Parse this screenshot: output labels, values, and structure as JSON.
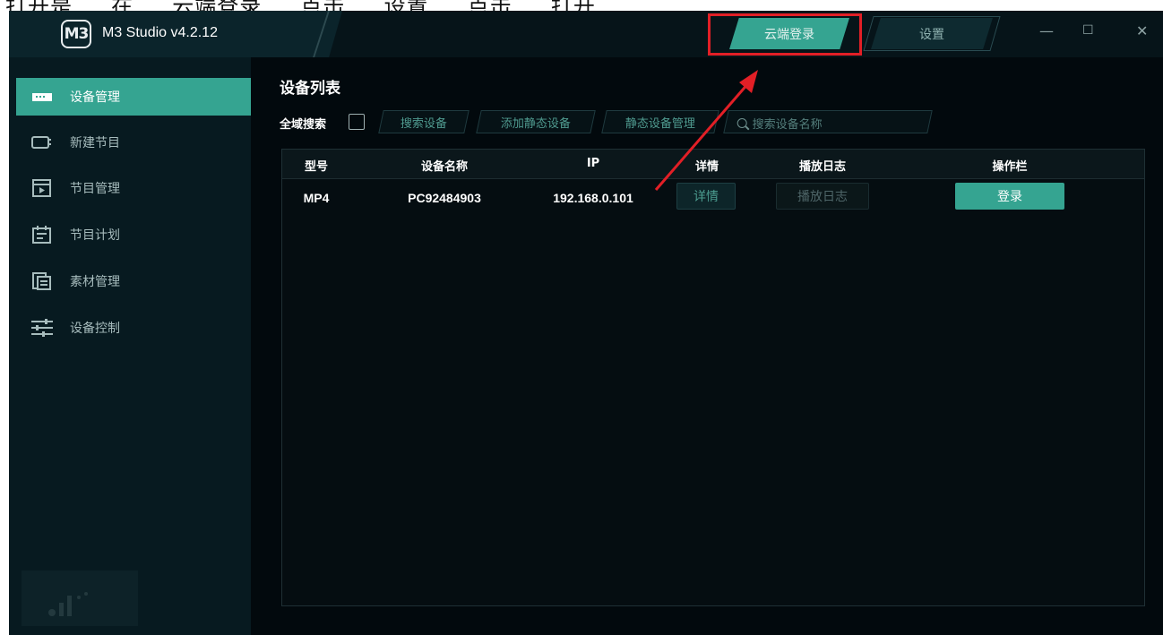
{
  "doc_strip": {
    "text": "打开是 ... 在 ... 云端登录 ... 点击 ... 设置 ... 点击 ... 打开"
  },
  "window": {
    "title": "M3 Studio v4.2.12",
    "logo_text": "M3",
    "cloud_login_label": "云端登录",
    "settings_label": "设置",
    "minimize_glyph": "—",
    "maximize_glyph": "☐",
    "close_glyph": "✕"
  },
  "sidebar": {
    "items": [
      {
        "label": "设备管理",
        "icon": "device-icon",
        "active": true
      },
      {
        "label": "新建节目",
        "icon": "new-program-icon",
        "active": false
      },
      {
        "label": "节目管理",
        "icon": "program-manage-icon",
        "active": false
      },
      {
        "label": "节目计划",
        "icon": "schedule-icon",
        "active": false
      },
      {
        "label": "素材管理",
        "icon": "material-icon",
        "active": false
      },
      {
        "label": "设备控制",
        "icon": "control-sliders-icon",
        "active": false
      }
    ]
  },
  "main": {
    "title": "设备列表",
    "global_search_label": "全域搜索",
    "buttons": {
      "search_devices": "搜索设备",
      "add_static_device": "添加静态设备",
      "static_device_manage": "静态设备管理"
    },
    "search": {
      "placeholder": "搜索设备名称"
    },
    "table": {
      "headers": [
        "型号",
        "设备名称",
        "IP",
        "详情",
        "播放日志",
        "操作栏"
      ],
      "rows": [
        {
          "model": "MP4",
          "name": "PC92484903",
          "ip": "192.168.0.101",
          "detail_btn": "详情",
          "log_btn": "播放日志",
          "action_btn": "登录"
        }
      ]
    }
  },
  "colors": {
    "accent": "#35a491",
    "background": "#02090d",
    "highlight": "#e21f26"
  }
}
